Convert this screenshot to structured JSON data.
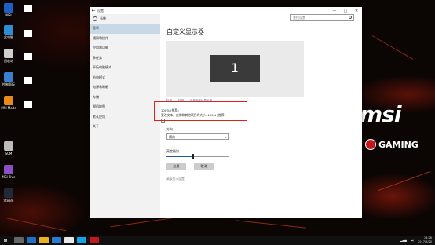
{
  "desktop": {
    "icons": [
      {
        "label": "MSI",
        "color": "#1f5fc4"
      },
      {
        "label": "此电脑",
        "color": "#2c8fd6"
      },
      {
        "label": "回收站",
        "color": "#cfcfcf"
      },
      {
        "label": "控制面板",
        "color": "#3a7fd0"
      },
      {
        "label": "MSI Mode",
        "color": "#e68a1c"
      },
      {
        "label": "SCM",
        "color": "#bbbbbb"
      },
      {
        "label": "MSI True",
        "color": "#8a4fc8"
      },
      {
        "label": "Steam",
        "color": "#202a38"
      }
    ],
    "brand": "msi",
    "brand_sub": "GAMING"
  },
  "window": {
    "title": "设置",
    "back_glyph": "←",
    "controls": {
      "minimize": "—",
      "maximize": "□",
      "close": "✕"
    },
    "home_label": "系统",
    "search_placeholder": "查找设置",
    "nav_items": [
      {
        "label": "显示",
        "active": true
      },
      {
        "label": "通知和操作",
        "active": false
      },
      {
        "label": "应用和功能",
        "active": false
      },
      {
        "label": "多任务",
        "active": false
      },
      {
        "label": "平板电脑模式",
        "active": false
      },
      {
        "label": "节电模式",
        "active": false
      },
      {
        "label": "电源和睡眠",
        "active": false
      },
      {
        "label": "存储",
        "active": false
      },
      {
        "label": "脱机地图",
        "active": false
      },
      {
        "label": "默认应用",
        "active": false
      },
      {
        "label": "关于",
        "active": false
      }
    ]
  },
  "content": {
    "title": "自定义显示器",
    "monitor_number": "1",
    "links": [
      "标识",
      "检测",
      "连接到无线显示器"
    ],
    "scale_percent": "100% (推荐)",
    "scale_description": "更改文本、应用和其他项目的大小: 100% (推荐)",
    "orientation_label": "方向",
    "orientation_value": "横向",
    "brightness_label": "亮度级别",
    "brightness_level": 0.42,
    "apply_label": "应用",
    "cancel_label": "取消",
    "advanced_link": "高级显示设置"
  },
  "taskbar": {
    "start_glyph": "⊞",
    "apps": [
      {
        "color": "#666666"
      },
      {
        "color": "#1f6fc4"
      },
      {
        "color": "#e8b31c"
      },
      {
        "color": "#2a7ad6"
      },
      {
        "color": "#e8e8e8"
      },
      {
        "color": "#0ea5e9"
      },
      {
        "color": "#c4161c"
      }
    ],
    "time": "14:26",
    "date": "2017/3/20"
  },
  "colors": {
    "accent": "#1a5aa6",
    "highlight_box": "#e0201a"
  }
}
